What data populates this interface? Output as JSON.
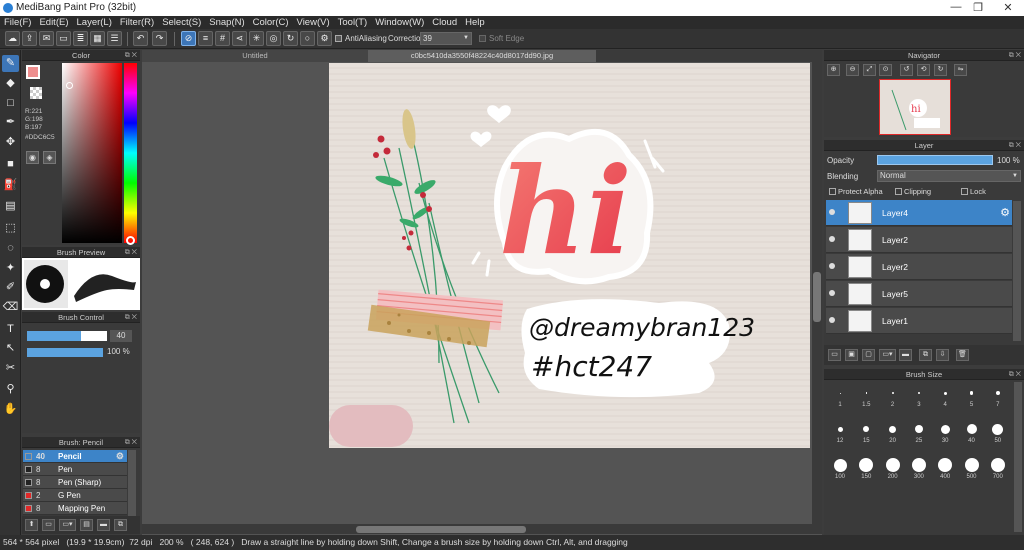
{
  "window": {
    "title": "MediBang Paint Pro (32bit)",
    "min": "—",
    "max": "❐",
    "close": "✕"
  },
  "menu": [
    "File(F)",
    "Edit(E)",
    "Layer(L)",
    "Filter(R)",
    "Select(S)",
    "Snap(N)",
    "Color(C)",
    "View(V)",
    "Tool(T)",
    "Window(W)",
    "Cloud",
    "Help"
  ],
  "toolbar": {
    "antialiasing_label": "AntiAliasing",
    "correction_label": "Correction",
    "correction_value": "39",
    "soft_edge_label": "Soft Edge"
  },
  "tabs": {
    "tab1": "Untitled",
    "tab2": "c0bc5410da3550f48224c40d8017dd90.jpg"
  },
  "color_panel": {
    "title": "Color",
    "r": "R:221",
    "g": "G:198",
    "b": "B:197",
    "hex": "#DDC6C5",
    "fg_color": "#DDC6C5"
  },
  "brush_preview": {
    "title": "Brush Preview"
  },
  "brush_control": {
    "title": "Brush Control",
    "size_value": "40",
    "opacity_value": "100 %",
    "size_fraction": 0.67,
    "opacity_fraction": 1.0
  },
  "brush_list": {
    "title": "Brush: Pencil",
    "items": [
      {
        "size": "40",
        "name": "Pencil",
        "color": "#3d84c8"
      },
      {
        "size": "8",
        "name": "Pen",
        "color": "#222222"
      },
      {
        "size": "8",
        "name": "Pen (Sharp)",
        "color": "#222222"
      },
      {
        "size": "2",
        "name": "G Pen",
        "color": "#e02828"
      },
      {
        "size": "8",
        "name": "Mapping Pen",
        "color": "#e02828"
      }
    ]
  },
  "navigator": {
    "title": "Navigator"
  },
  "layer_panel": {
    "title": "Layer",
    "opacity_label": "Opacity",
    "opacity_value": "100 %",
    "blending_label": "Blending",
    "blending_value": "Normal",
    "protect_alpha": "Protect Alpha",
    "clipping": "Clipping",
    "lock": "Lock",
    "layers": [
      "Layer4",
      "Layer2",
      "Layer2",
      "Layer5",
      "Layer1"
    ]
  },
  "brush_size": {
    "title": "Brush Size",
    "sizes": [
      "1",
      "1.5",
      "2",
      "3",
      "4",
      "5",
      "7",
      "12",
      "15",
      "20",
      "25",
      "30",
      "40",
      "50",
      "100",
      "150",
      "200",
      "300",
      "400",
      "500",
      "700"
    ]
  },
  "artwork": {
    "hi": "hi",
    "handle": "@dreamybran123",
    "hashtag": "#hct247"
  },
  "status": {
    "dims": "564 * 564 pixel",
    "size_cm": "(19.9 * 19.9cm)",
    "dpi": "72 dpi",
    "zoom": "200 %",
    "coords": "( 248, 624 )",
    "hint": "Draw a straight line by holding down Shift, Change a brush size by holding down Ctrl, Alt, and dragging"
  }
}
